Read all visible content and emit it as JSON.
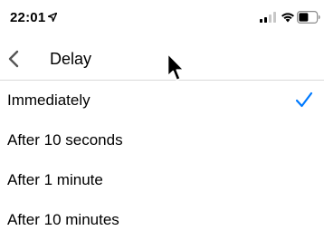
{
  "status_bar": {
    "time": "22:01",
    "icons": [
      "location-arrow-icon",
      "cellular-signal-icon",
      "wifi-icon",
      "battery-icon"
    ]
  },
  "nav": {
    "title": "Delay",
    "back_icon": "chevron-left-icon"
  },
  "options": [
    {
      "label": "Immediately",
      "selected": true
    },
    {
      "label": "After 10 seconds",
      "selected": false
    },
    {
      "label": "After 1 minute",
      "selected": false
    },
    {
      "label": "After 10 minutes",
      "selected": false
    }
  ],
  "colors": {
    "accent": "#007aff",
    "separator": "#d9d9d9",
    "chevron": "#555555"
  }
}
